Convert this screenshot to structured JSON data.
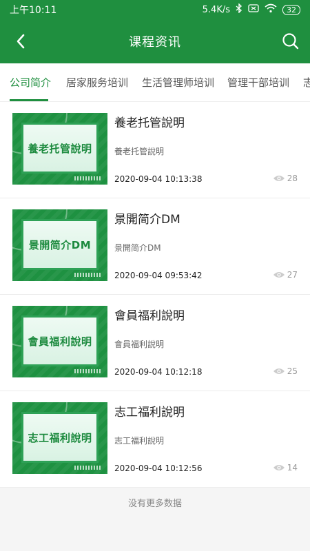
{
  "status_bar": {
    "time": "上午10:11",
    "speed": "5.4K/s",
    "battery": "32"
  },
  "header": {
    "title": "课程资讯"
  },
  "tabs": [
    {
      "label": "公司简介",
      "active": true
    },
    {
      "label": "居家服务培训",
      "active": false
    },
    {
      "label": "生活管理师培训",
      "active": false
    },
    {
      "label": "管理干部培训",
      "active": false
    },
    {
      "label": "志",
      "active": false
    }
  ],
  "items": [
    {
      "thumb_text": "養老托管說明",
      "title": "養老托管說明",
      "subtitle": "養老托管說明",
      "date": "2020-09-04 10:13:38",
      "views": "28"
    },
    {
      "thumb_text": "景開简介DM",
      "title": "景開简介DM",
      "subtitle": "景開简介DM",
      "date": "2020-09-04 09:53:42",
      "views": "27"
    },
    {
      "thumb_text": "會員福利說明",
      "title": "會員福利說明",
      "subtitle": "會員福利說明",
      "date": "2020-09-04 10:12:18",
      "views": "25"
    },
    {
      "thumb_text": "志工福利說明",
      "title": "志工福利說明",
      "subtitle": "志工福利說明",
      "date": "2020-09-04 10:12:56",
      "views": "14"
    }
  ],
  "footer": {
    "no_more": "没有更多数据"
  },
  "colors": {
    "primary": "#1f8f3f"
  }
}
